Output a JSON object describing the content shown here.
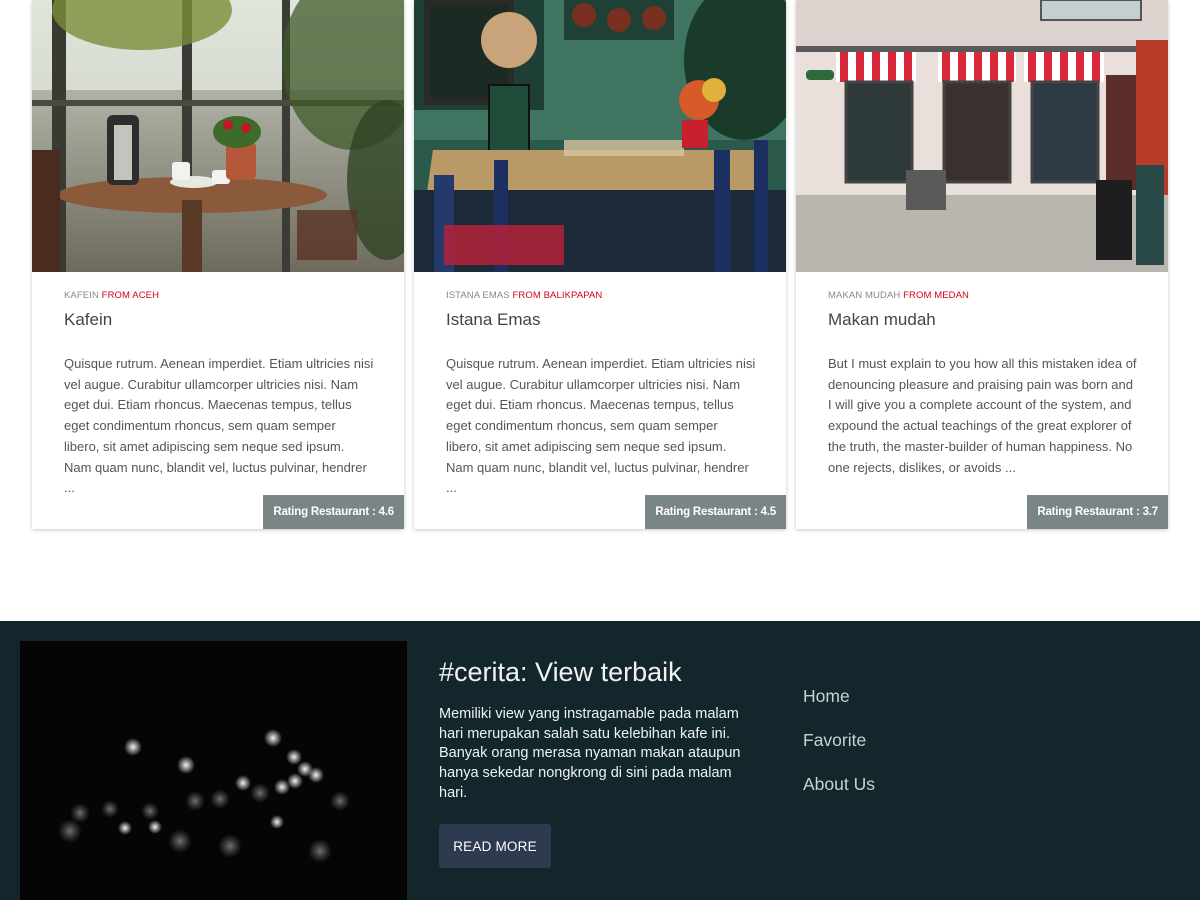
{
  "cards": [
    {
      "meta_name": "KAFEIN",
      "meta_from": "FROM ACEH",
      "title": "Kafein",
      "description": "Quisque rutrum. Aenean imperdiet. Etiam ultricies nisi vel augue. Curabitur ullamcorper ultricies nisi. Nam eget dui. Etiam rhoncus. Maecenas tempus, tellus eget condimentum rhoncus, sem quam semper libero, sit amet adipiscing sem neque sed ipsum. Nam quam nunc, blandit vel, luctus pulvinar, hendrer ...",
      "rating": "Rating Restaurant : 4.6"
    },
    {
      "meta_name": "ISTANA EMAS",
      "meta_from": "FROM BALIKPAPAN",
      "title": "Istana Emas",
      "description": "Quisque rutrum. Aenean imperdiet. Etiam ultricies nisi vel augue. Curabitur ullamcorper ultricies nisi. Nam eget dui. Etiam rhoncus. Maecenas tempus, tellus eget condimentum rhoncus, sem quam semper libero, sit amet adipiscing sem neque sed ipsum. Nam quam nunc, blandit vel, luctus pulvinar, hendrer ...",
      "rating": "Rating Restaurant : 4.5"
    },
    {
      "meta_name": "MAKAN MUDAH",
      "meta_from": "FROM MEDAN",
      "title": "Makan mudah",
      "description": "But I must explain to you how all this mistaken idea of denouncing pleasure and praising pain was born and I will give you a complete account of the system, and expound the actual teachings of the great explorer of the truth, the master-builder of human happiness. No one rejects, dislikes, or avoids ...",
      "rating": "Rating Restaurant : 3.7"
    }
  ],
  "footer": {
    "title": "#cerita: View terbaik",
    "text": "Memiliki view yang instragamable pada malam hari merupakan salah satu kelebihan kafe ini. Banyak orang merasa nyaman makan ataupun hanya sekedar nongkrong di sini pada malam hari.",
    "button_label": "READ MORE",
    "nav": [
      "Home",
      "Favorite",
      "About Us"
    ]
  },
  "colors": {
    "accent_red": "#d0021b",
    "rating_bg": "#7a8585",
    "footer_bg": "#13262b",
    "button_bg": "#2e3a4f"
  }
}
